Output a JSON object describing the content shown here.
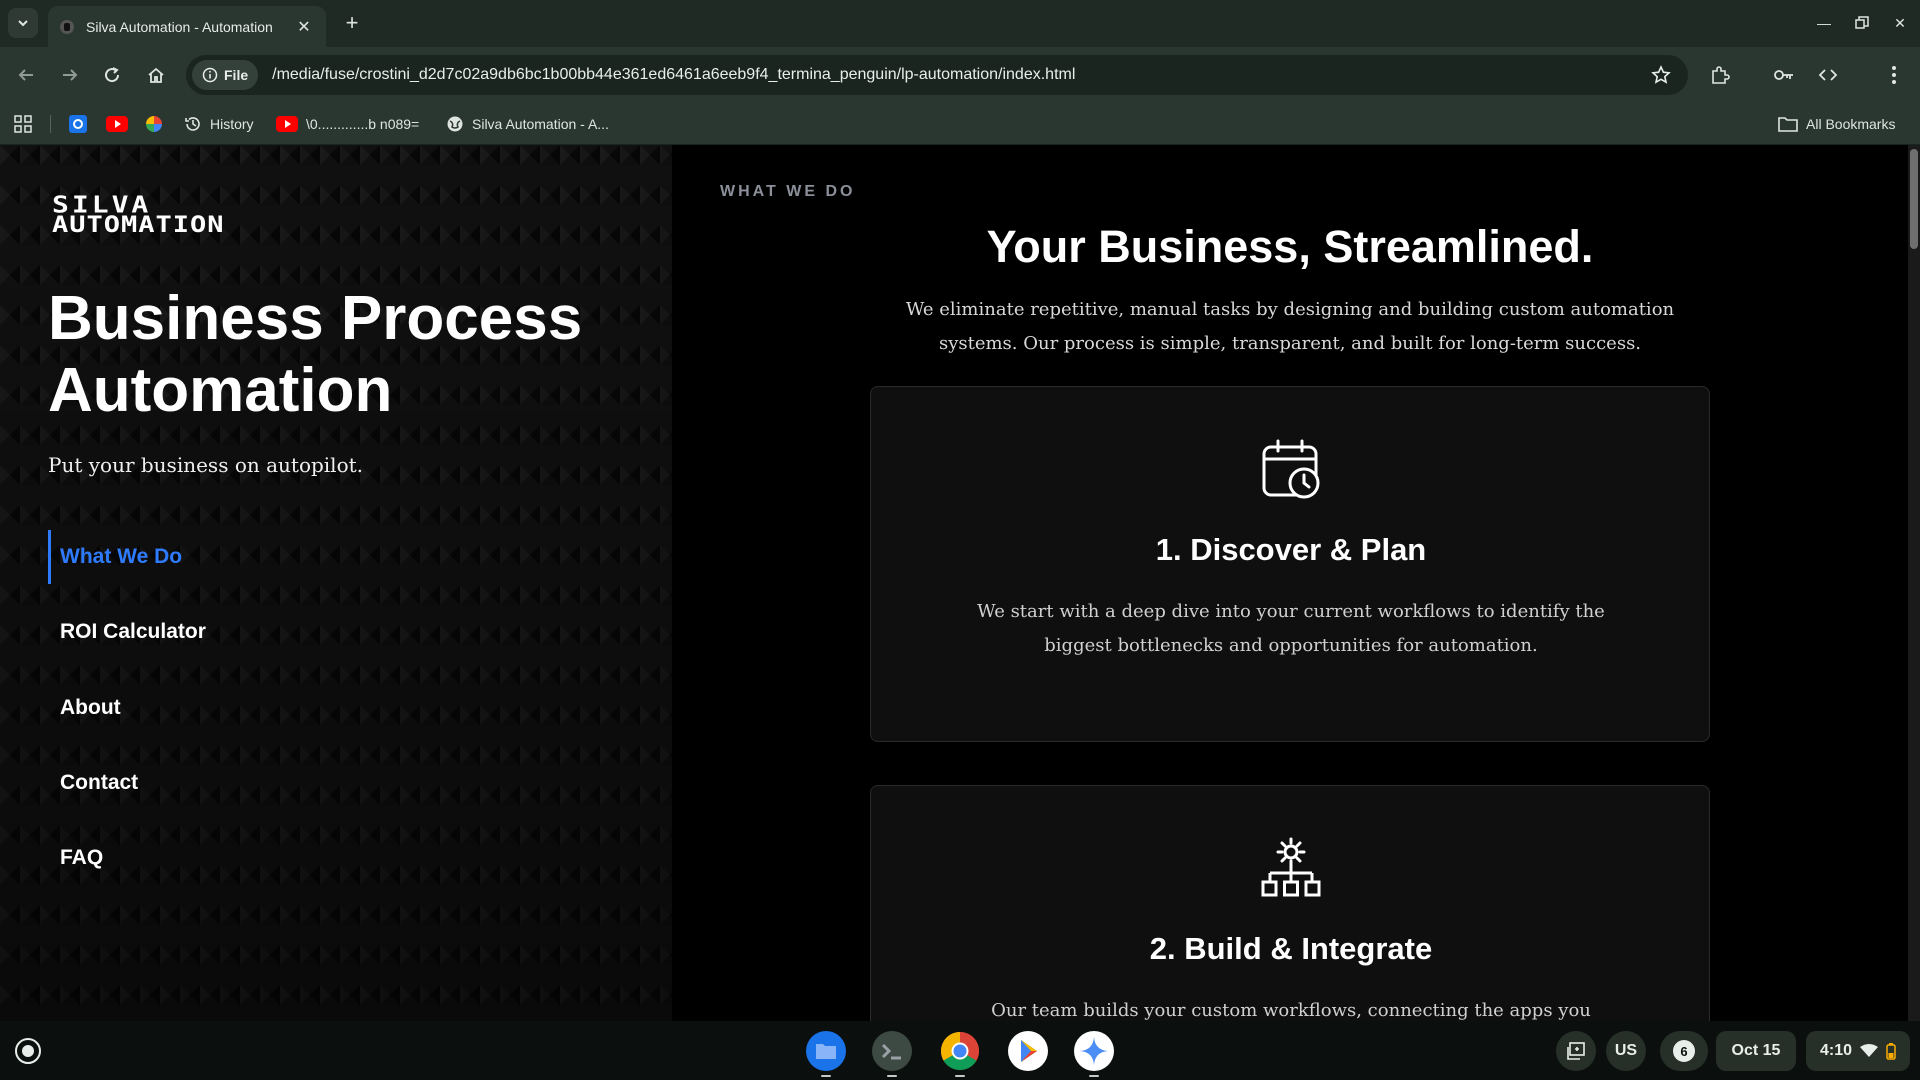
{
  "browser": {
    "tab_title": "Silva Automation - Automation",
    "address_chip": "File",
    "url": "/media/fuse/crostini_d2d7c02a9db6bc1b00bb44e361ed6461a6eeb9f4_termina_penguin/lp-automation/index.html",
    "bookmarks": [
      {
        "label": "History",
        "icon": "history-icon"
      },
      {
        "label": "\\0.............b n089=",
        "icon": "youtube-icon"
      },
      {
        "label": "Silva Automation - A...",
        "icon": "globe-icon"
      }
    ],
    "all_bookmarks_label": "All Bookmarks"
  },
  "sidebar": {
    "logo_line1": "SILVA",
    "logo_line2": "AUTOMATION",
    "hero_title": "Business Process Automation",
    "hero_subtitle": "Put your business on autopilot.",
    "nav": [
      {
        "label": "What We Do",
        "active": true
      },
      {
        "label": "ROI Calculator",
        "active": false
      },
      {
        "label": "About",
        "active": false
      },
      {
        "label": "Contact",
        "active": false
      },
      {
        "label": "FAQ",
        "active": false
      }
    ],
    "active_color": "#2f7bff"
  },
  "main": {
    "eyebrow": "WHAT WE DO",
    "title": "Your Business, Streamlined.",
    "description": "We eliminate repetitive, manual tasks by designing and building custom automation systems. Our process is simple, transparent, and built for long-term success.",
    "cards": [
      {
        "icon": "calendar-clock-icon",
        "title": "1. Discover & Plan",
        "text": "We start with a deep dive into your current workflows to identify the biggest bottlenecks and opportunities for automation."
      },
      {
        "icon": "gear-network-icon",
        "title": "2. Build & Integrate",
        "text": "Our team builds your custom workflows, connecting the apps you already use to create a"
      }
    ]
  },
  "shelf": {
    "apps": [
      "files-icon",
      "terminal-icon",
      "chrome-icon",
      "play-store-icon",
      "gemini-icon"
    ],
    "keyboard_layout": "US",
    "notification_count": "6",
    "date": "Oct 15",
    "time": "4:10"
  }
}
